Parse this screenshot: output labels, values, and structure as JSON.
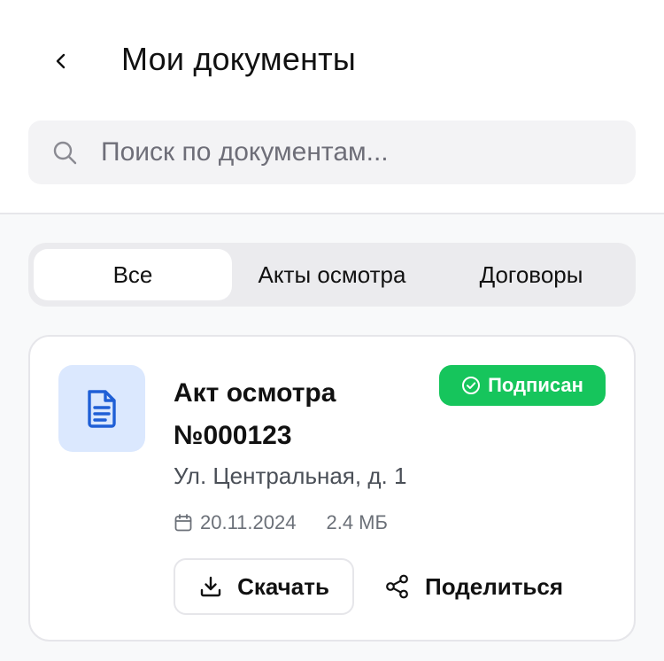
{
  "header": {
    "back_icon": "chevron-left-icon",
    "title": "Мои документы"
  },
  "search": {
    "icon": "search-icon",
    "placeholder": "Поиск по документам..."
  },
  "tabs": [
    {
      "label": "Все",
      "active": true
    },
    {
      "label": "Акты осмотра",
      "active": false
    },
    {
      "label": "Договоры",
      "active": false
    }
  ],
  "documents": [
    {
      "icon": "document-icon",
      "title": "Акт осмотра №000123",
      "status": {
        "label": "Подписан",
        "icon": "check-circle-icon",
        "color": "#16c55c"
      },
      "address": "Ул. Центральная, д. 1",
      "date_icon": "calendar-icon",
      "date": "20.11.2024",
      "size": "2.4 МБ",
      "actions": {
        "download": {
          "label": "Скачать",
          "icon": "download-icon"
        },
        "share": {
          "label": "Поделиться",
          "icon": "share-icon"
        }
      }
    }
  ],
  "colors": {
    "accent_blue": "#1f5fd6",
    "icon_bg": "#dbe8fe",
    "status_green": "#16c55c"
  }
}
